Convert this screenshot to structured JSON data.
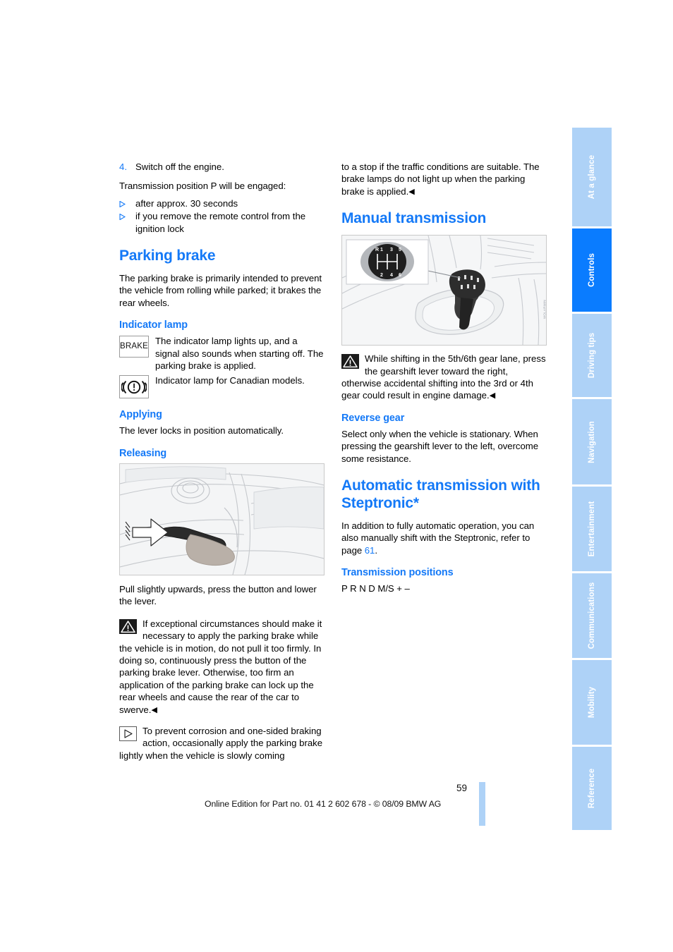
{
  "document": {
    "page_number": "59",
    "footer_text": "Online Edition for Part no. 01 41 2 602 678 - © 08/09 BMW AG"
  },
  "colors": {
    "heading_blue": "#1479f7",
    "tab_active": "#0a7cff",
    "tab_inactive": "#aed2f7",
    "text": "#000000"
  },
  "left_column": {
    "step": {
      "number": "4.",
      "text": "Switch off the engine."
    },
    "intro": "Transmission position P will be engaged:",
    "bullets": [
      "after approx. 30 seconds",
      "if you remove the remote control from the ignition lock"
    ],
    "parking_brake": {
      "heading": "Parking brake",
      "intro": "The parking brake is primarily intended to prevent the vehicle from rolling while parked; it brakes the rear wheels.",
      "indicator_lamp": {
        "heading": "Indicator lamp",
        "rows": [
          {
            "icon": "brake-lamp-icon",
            "icon_text": "BRAKE",
            "text": "The indicator lamp lights up, and a signal also sounds when starting off. The parking brake is applied."
          },
          {
            "icon": "canadian-brake-lamp-icon",
            "icon_text": "",
            "text": "Indicator lamp for Canadian models."
          }
        ]
      },
      "applying": {
        "heading": "Applying",
        "text": "The lever locks in position automatically."
      },
      "releasing": {
        "heading": "Releasing",
        "figure_alt": "Parking brake lever with arrow pointing at release button",
        "text": "Pull slightly upwards, press the button and lower the lever.",
        "warning": "If exceptional circumstances should make it necessary to apply the parking brake while the vehicle is in motion, do not pull it too firmly. In doing so, continuously press the button of the parking brake lever. Otherwise, too firm an application of the parking brake can lock up the rear wheels and cause the rear of the car to swerve.",
        "note": "To prevent corrosion and one-sided braking action, occasionally apply the parking brake lightly when the vehicle is slowly coming"
      }
    }
  },
  "right_column": {
    "continuation": "to a stop if the traffic conditions are suitable. The brake lamps do not light up when the parking brake is applied.",
    "manual_transmission": {
      "heading": "Manual transmission",
      "figure": {
        "alt": "Manual gearshift lever in centre console with shift pattern inset",
        "shift_pattern_top": "R 1 3 5",
        "shift_pattern_bottom": "2 4 6",
        "caption_code": "WOLARMIN"
      },
      "warning": "While shifting in the 5th/6th gear lane, press the gearshift lever toward the right, otherwise accidental shifting into the 3rd or 4th gear could result in engine damage.",
      "reverse_gear": {
        "heading": "Reverse gear",
        "text": "Select only when the vehicle is stationary. When pressing the gearshift lever to the left, overcome some resistance."
      }
    },
    "automatic_transmission": {
      "heading": "Automatic transmission with Steptronic*",
      "intro_before": "In addition to fully automatic operation, you can also manually shift with the Steptronic, refer to page ",
      "page_ref": "61",
      "intro_after": ".",
      "transmission_positions": {
        "heading": "Transmission positions",
        "text": "P R N D M/S + –"
      }
    }
  },
  "side_rail": {
    "tabs": [
      {
        "label": "At a glance",
        "active": false
      },
      {
        "label": "Controls",
        "active": true
      },
      {
        "label": "Driving tips",
        "active": false
      },
      {
        "label": "Navigation",
        "active": false
      },
      {
        "label": "Entertainment",
        "active": false
      },
      {
        "label": "Communications",
        "active": false
      },
      {
        "label": "Mobility",
        "active": false
      },
      {
        "label": "Reference",
        "active": false
      }
    ]
  }
}
